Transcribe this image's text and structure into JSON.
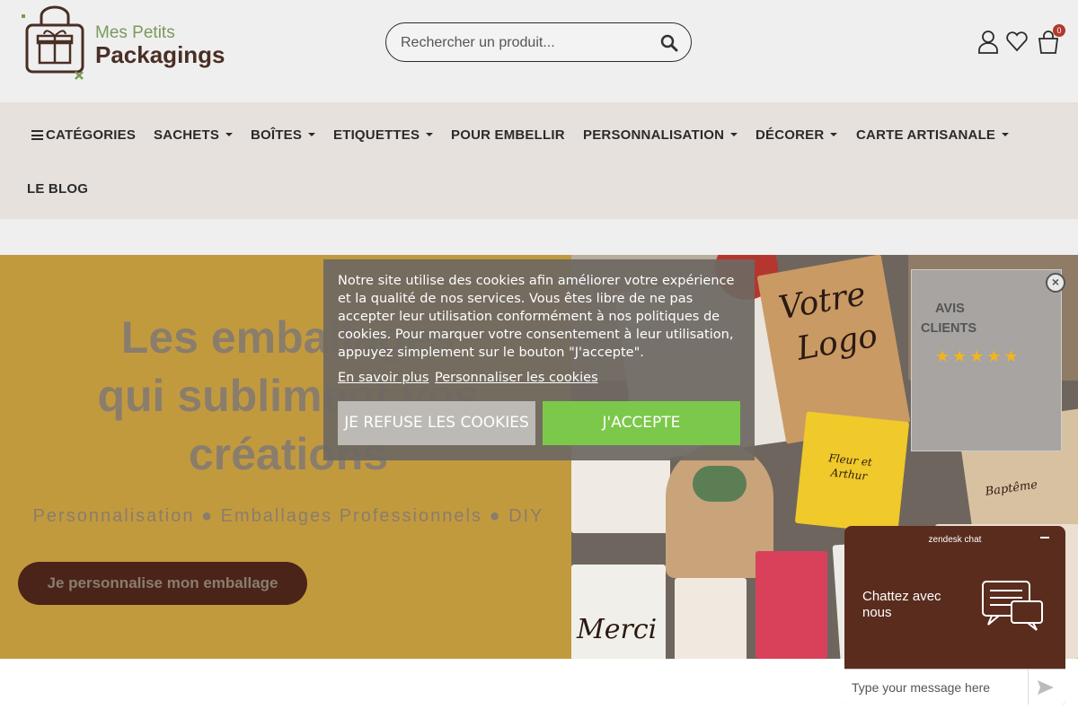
{
  "header": {
    "logo_line1": "Mes Petits",
    "logo_line2": "Packagings",
    "search_placeholder": "Rechercher un produit...",
    "cart_count": "0",
    "icons": [
      "account-icon",
      "wishlist-heart-icon",
      "cart-bag-icon",
      "search-icon"
    ]
  },
  "nav": {
    "items": [
      {
        "label": "CATÉGORIES"
      },
      {
        "label": "SACHETS"
      },
      {
        "label": "BOÎTES"
      },
      {
        "label": "ETIQUETTES"
      },
      {
        "label": "POUR EMBELLIR"
      },
      {
        "label": "PERSONNALISATION"
      },
      {
        "label": "DÉCORER"
      },
      {
        "label": "CARTE ARTISANALE"
      },
      {
        "label": "LE BLOG"
      }
    ]
  },
  "hero": {
    "title_line1": "Les emballages",
    "title_line2": "qui subliment vos",
    "title_line3": "créations",
    "subtitle": "Personnalisation ● Emballages Professionnels ● DIY",
    "cta": "Je personnalise mon emballage",
    "image_texts": {
      "votre": "Votre",
      "logo": "Logo",
      "merci": "Merci",
      "fleur": "Fleur et",
      "arthur": "Arthur",
      "bapteme": "Baptême"
    }
  },
  "cookie": {
    "text": "Notre site utilise des cookies afin améliorer votre expérience et la qualité de nos services. Vous êtes libre de ne pas accepter leur utilisation conformément à nos politiques de cookies. Pour marquer votre consentement à leur utilisation, appuyez simplement sur le bouton \"J'accepte\".",
    "link_more": "En savoir plus",
    "link_customize": "Personnaliser les cookies",
    "refuse": "JE REFUSE LES COOKIES",
    "accept": "J'ACCEPTE",
    "accept_color": "#7cc84a"
  },
  "avis": {
    "line1": "AVIS",
    "line2": "CLIENTS",
    "stars": "★★★★★",
    "rating": 5
  },
  "chat": {
    "title": "zendesk chat",
    "body": "Chattez avec nous",
    "placeholder": "Type your message here"
  },
  "colors": {
    "brand_brown": "#4a2418",
    "hero_gold": "#c29a3e",
    "nav_bg": "#e6e1dd"
  }
}
